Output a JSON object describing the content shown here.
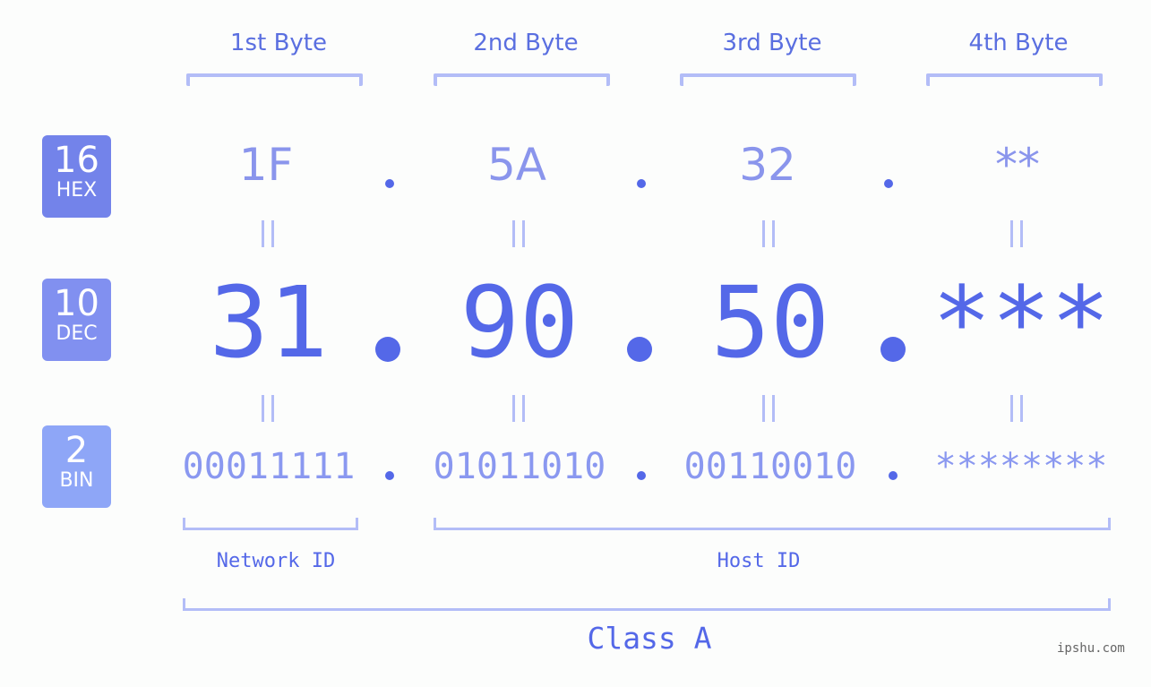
{
  "bytes": [
    {
      "label": "1st Byte",
      "hex": "1F",
      "dec": "31",
      "bin": "00011111"
    },
    {
      "label": "2nd Byte",
      "hex": "5A",
      "dec": "90",
      "bin": "01011010"
    },
    {
      "label": "3rd Byte",
      "hex": "32",
      "dec": "50",
      "bin": "00110010"
    },
    {
      "label": "4th Byte",
      "hex": "**",
      "dec": "***",
      "bin": "********"
    }
  ],
  "separator": ".",
  "bases": [
    {
      "num": "16",
      "name": "HEX",
      "color": "#7383ea"
    },
    {
      "num": "10",
      "name": "DEC",
      "color": "#8190f0"
    },
    {
      "num": "2",
      "name": "BIN",
      "color": "#8ea6f7"
    }
  ],
  "id_labels": {
    "network": "Network ID",
    "host": "Host ID"
  },
  "class_label": "Class A",
  "watermark": "ipshu.com",
  "colors": {
    "accent": "#5468e8",
    "bracket": "#b3bdf7",
    "hex_text": "#8a95ec",
    "bin_text": "#8a98f0"
  }
}
